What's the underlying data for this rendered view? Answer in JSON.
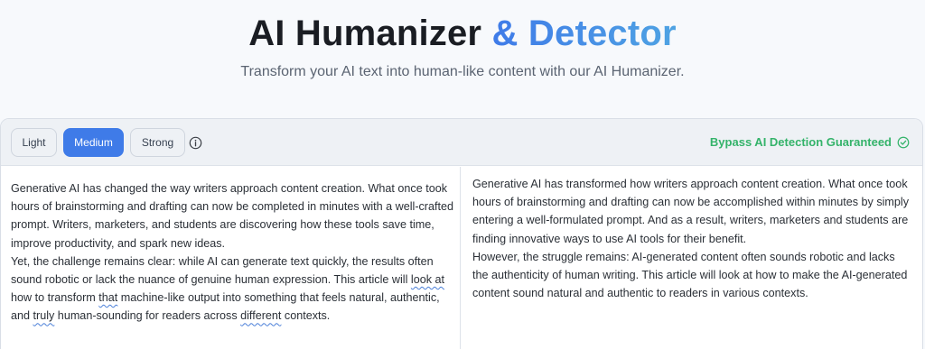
{
  "hero": {
    "title_main": "AI Humanizer",
    "title_accent": "& Detector",
    "subtitle": "Transform your AI text into human-like content with our AI Humanizer."
  },
  "toolbar": {
    "modes": [
      {
        "label": "Light",
        "active": false
      },
      {
        "label": "Medium",
        "active": true
      },
      {
        "label": "Strong",
        "active": false
      }
    ],
    "guarantee_label": "Bypass AI Detection Guaranteed",
    "guarantee_color": "#34b36a",
    "accent_color": "#3f7be8",
    "info_icon": "info-circle-icon",
    "check_icon": "check-circle-icon"
  },
  "input": {
    "paragraph1": "Generative AI has changed the way writers approach content creation. What once took hours of brainstorming and drafting can now be completed in minutes with a well-crafted prompt. Writers, marketers, and students are discovering how these tools save time, improve productivity, and spark new ideas.",
    "p2_a": "Yet, the challenge remains clear: while AI can generate text quickly, the results often sound robotic or lack the nuance of genuine human expression. This article will ",
    "p2_b": "look at",
    "p2_c": " how to transform ",
    "p2_d": "that",
    "p2_e": " machine-like output into something that feels natural, authentic, and ",
    "p2_f": "truly",
    "p2_g": " human-sounding for readers across ",
    "p2_h": "different",
    "p2_i": " contexts."
  },
  "output": {
    "paragraph1": "Generative AI has transformed how writers approach content creation. What once took hours of brainstorming and drafting can now be accomplished within minutes by simply entering a well-formulated prompt. And as a result, writers, marketers and students are finding innovative ways to use AI tools for their benefit.",
    "paragraph2": "However, the struggle remains: AI-generated content often sounds robotic and lacks the authenticity of human writing. This article will look at how to make the AI-generated content sound natural and authentic to readers in various contexts."
  }
}
